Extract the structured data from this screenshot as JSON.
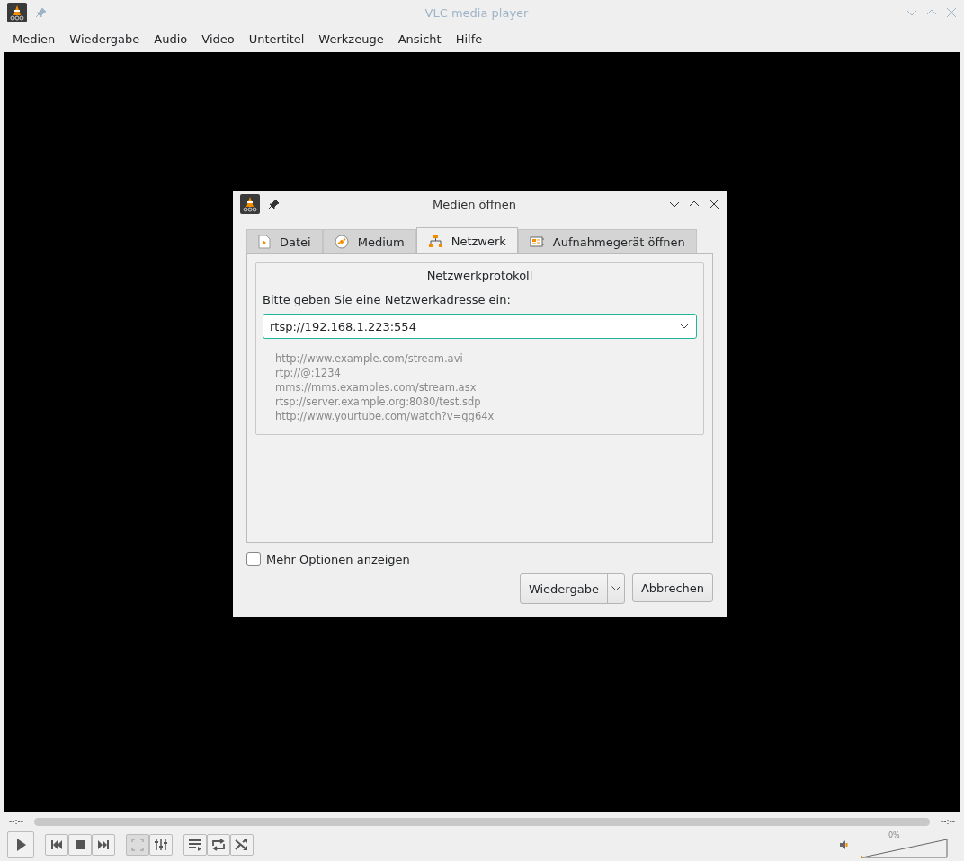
{
  "window": {
    "title": "VLC media player"
  },
  "menu": [
    "Medien",
    "Wiedergabe",
    "Audio",
    "Video",
    "Untertitel",
    "Werkzeuge",
    "Ansicht",
    "Hilfe"
  ],
  "dialog": {
    "title": "Medien öffnen",
    "tabs": [
      {
        "label": "Datei",
        "kind": "file",
        "selected": false
      },
      {
        "label": "Medium",
        "kind": "disc",
        "selected": false
      },
      {
        "label": "Netzwerk",
        "kind": "network",
        "selected": true
      },
      {
        "label": "Aufnahmegerät öffnen",
        "kind": "capture",
        "selected": false
      }
    ],
    "group_title": "Netzwerkprotokoll",
    "prompt": "Bitte geben Sie eine Netzwerkadresse ein:",
    "address": "rtsp://192.168.1.223:554",
    "examples": [
      "http://www.example.com/stream.avi",
      "rtp://@:1234",
      "mms://mms.examples.com/stream.asx",
      "rtsp://server.example.org:8080/test.sdp",
      "http://www.yourtube.com/watch?v=gg64x"
    ],
    "more_options": {
      "label": "Mehr Optionen anzeigen",
      "checked": false
    },
    "buttons": [
      "Wiedergabe",
      "Abbrechen"
    ]
  },
  "player": {
    "elapsed": "--:--",
    "remaining": "--:--",
    "controls": [
      {
        "kind": "play",
        "disabled": false
      },
      {
        "kind": "prev",
        "disabled": false
      },
      {
        "kind": "stop",
        "disabled": false
      },
      {
        "kind": "next",
        "disabled": false
      },
      {
        "kind": "fullscreen",
        "disabled": true
      },
      {
        "kind": "settings",
        "disabled": false
      },
      {
        "kind": "playlist",
        "disabled": false
      },
      {
        "kind": "loop",
        "disabled": false
      },
      {
        "kind": "shuffle",
        "disabled": false
      }
    ],
    "volume": {
      "reading": "0%",
      "level": 0
    }
  }
}
